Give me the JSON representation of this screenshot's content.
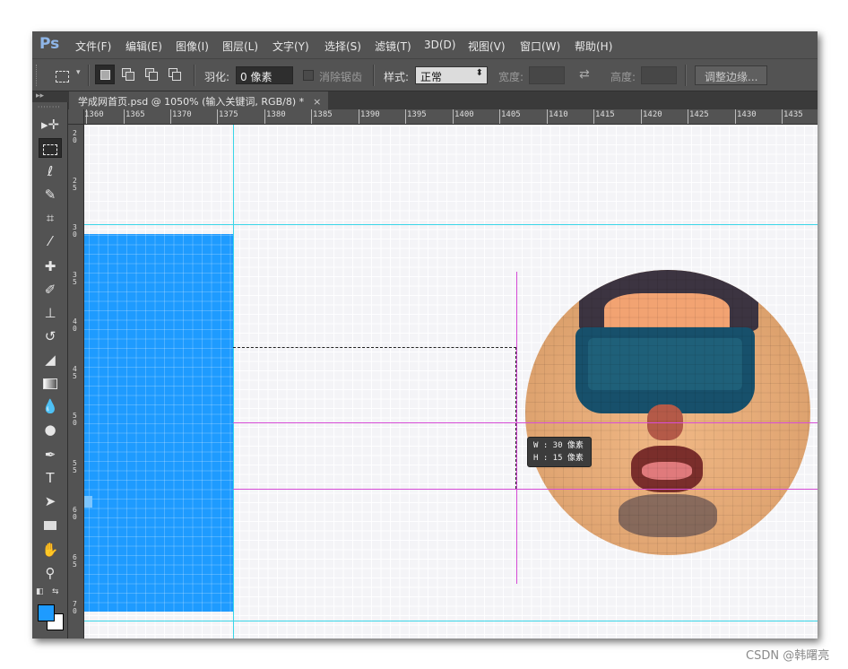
{
  "app": {
    "logo": "Ps"
  },
  "menu": [
    "文件(F)",
    "编辑(E)",
    "图像(I)",
    "图层(L)",
    "文字(Y)",
    "选择(S)",
    "滤镜(T)",
    "3D(D)",
    "视图(V)",
    "窗口(W)",
    "帮助(H)"
  ],
  "options": {
    "feather_label": "羽化:",
    "feather_value": "0 像素",
    "antialias_label": "消除锯齿",
    "style_label": "样式:",
    "style_value": "正常",
    "width_label": "宽度:",
    "height_label": "高度:",
    "refine_edge_button": "调整边缘..."
  },
  "document": {
    "tab_title": "学成网首页.psd @ 1050% (输入关键词, RGB/8) *",
    "close": "×"
  },
  "ruler": {
    "h_labels": [
      "1360",
      "1365",
      "1370",
      "1375",
      "1380",
      "1385",
      "1390",
      "1395",
      "1400",
      "1405",
      "1410",
      "1415",
      "1420",
      "1425",
      "1430",
      "1435"
    ],
    "v_labels": [
      "2 0",
      "2 5",
      "3 0",
      "3 5",
      "4 0",
      "4 5",
      "5 0",
      "5 5",
      "6 0",
      "6 5",
      "7 0"
    ]
  },
  "tooltip": {
    "width_line": "W : 30 像素",
    "height_line": "H : 15 像素"
  },
  "colors": {
    "foreground": "#1e9bff",
    "background": "#ffffff",
    "guide_cyan": "#39d6e8",
    "guide_magenta": "#d64bd6"
  },
  "tools": [
    "move-tool",
    "marquee-tool",
    "lasso-tool",
    "quick-selection-tool",
    "crop-tool",
    "eyedropper-tool",
    "healing-brush-tool",
    "brush-tool",
    "clone-stamp-tool",
    "history-brush-tool",
    "eraser-tool",
    "gradient-tool",
    "blur-tool",
    "dodge-tool",
    "pen-tool",
    "type-tool",
    "path-selection-tool",
    "rectangle-tool",
    "hand-tool",
    "zoom-tool"
  ],
  "watermark": "CSDN @韩曙亮"
}
